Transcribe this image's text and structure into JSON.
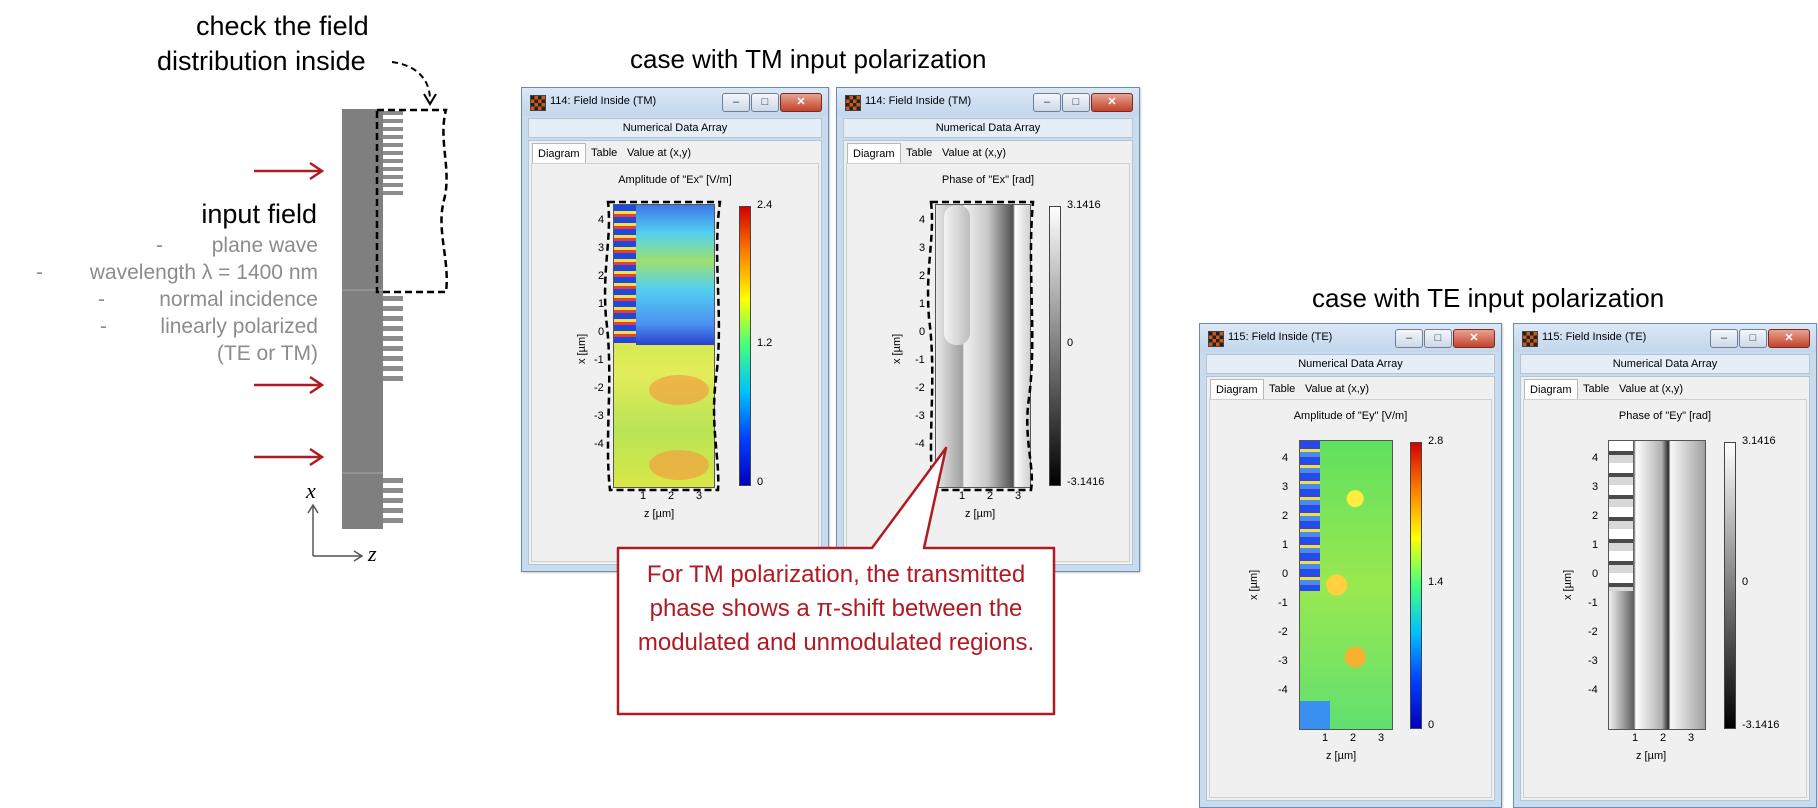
{
  "annotations": {
    "check_line1": "check the field",
    "check_line2": "distribution inside",
    "input_heading": "input field",
    "bullets": [
      {
        "dash": "-",
        "text": "plane wave"
      },
      {
        "dash": "-",
        "text": "wavelength λ = 1400 nm"
      },
      {
        "dash": "-",
        "text": "normal incidence"
      },
      {
        "dash": "-",
        "text": "linearly polarized"
      },
      {
        "dash": "",
        "text": "(TE or TM)"
      }
    ],
    "axis_x": "x",
    "axis_z": "z",
    "tm_heading": "case with TM input polarization",
    "te_heading": "case with TE input polarization",
    "callout": "For TM polarization, the transmitted phase shows a π-shift between the modulated and unmodulated regions."
  },
  "windows": [
    {
      "title": "114: Field Inside (TM)",
      "subtitle": "Numerical Data Array",
      "tabs": [
        "Diagram",
        "Table",
        "Value at (x,y)"
      ],
      "plot_title": "Amplitude of \"Ex\"  [V/m]",
      "colorbar_labels": [
        "2.4",
        "1.2",
        "0"
      ],
      "colorbar": "jet",
      "xlabel": "z [µm]",
      "ylabel": "x [µm]",
      "yticks": [
        "4",
        "3",
        "2",
        "1",
        "0",
        "-1",
        "-2",
        "-3",
        "-4"
      ],
      "xticks": [
        "1",
        "2",
        "3"
      ],
      "buttons": [
        "–",
        "□",
        "✕"
      ]
    },
    {
      "title": "114: Field Inside (TM)",
      "subtitle": "Numerical Data Array",
      "tabs": [
        "Diagram",
        "Table",
        "Value at (x,y)"
      ],
      "plot_title": "Phase of \"Ex\"  [rad]",
      "colorbar_labels": [
        "3.1416",
        "0",
        "-3.1416"
      ],
      "colorbar": "gray",
      "xlabel": "z [µm]",
      "ylabel": "x [µm]",
      "yticks": [
        "4",
        "3",
        "2",
        "1",
        "0",
        "-1",
        "-2",
        "-3",
        "-4"
      ],
      "xticks": [
        "1",
        "2",
        "3"
      ],
      "buttons": [
        "–",
        "□",
        "✕"
      ]
    },
    {
      "title": "115: Field Inside (TE)",
      "subtitle": "Numerical Data Array",
      "tabs": [
        "Diagram",
        "Table",
        "Value at (x,y)"
      ],
      "plot_title": "Amplitude of \"Ey\"  [V/m]",
      "colorbar_labels": [
        "2.8",
        "1.4",
        "0"
      ],
      "colorbar": "jet",
      "xlabel": "z [µm]",
      "ylabel": "x [µm]",
      "yticks": [
        "4",
        "3",
        "2",
        "1",
        "0",
        "-1",
        "-2",
        "-3",
        "-4"
      ],
      "xticks": [
        "1",
        "2",
        "3"
      ],
      "buttons": [
        "–",
        "□",
        "✕"
      ]
    },
    {
      "title": "115: Field Inside (TE)",
      "subtitle": "Numerical Data Array",
      "tabs": [
        "Diagram",
        "Table",
        "Value at (x,y)"
      ],
      "plot_title": "Phase of \"Ey\"  [rad]",
      "colorbar_labels": [
        "3.1416",
        "0",
        "-3.1416"
      ],
      "colorbar": "gray",
      "xlabel": "z [µm]",
      "ylabel": "x [µm]",
      "yticks": [
        "4",
        "3",
        "2",
        "1",
        "0",
        "-1",
        "-2",
        "-3",
        "-4"
      ],
      "xticks": [
        "1",
        "2",
        "3"
      ],
      "buttons": [
        "–",
        "□",
        "✕"
      ]
    }
  ],
  "colors": {
    "accent_red": "#b01a22",
    "grating": "#7f7f7f",
    "window_frame": "#c9dcee"
  }
}
